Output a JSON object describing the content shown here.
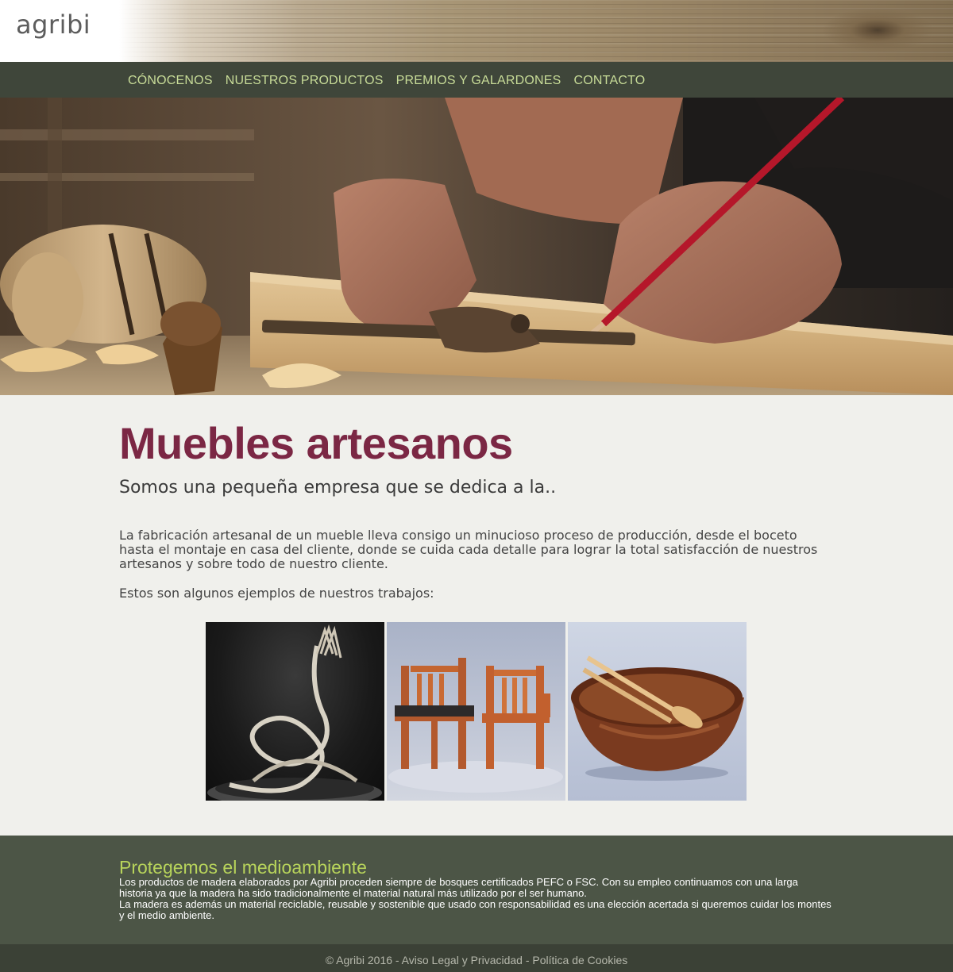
{
  "brand": {
    "logo_text": "agribi"
  },
  "nav": {
    "items": [
      {
        "label": "CÓNOCENOS"
      },
      {
        "label": "NUESTROS PRODUCTOS"
      },
      {
        "label": "PREMIOS Y GALARDONES"
      },
      {
        "label": "CONTACTO"
      }
    ]
  },
  "main": {
    "title": "Muebles artesanos",
    "subtitle": "Somos una pequeña empresa que se dedica a la..",
    "paragraph": "La fabricación artesanal de un mueble lleva consigo un minucioso proceso de producción, desde el boceto hasta el montaje en casa del cliente, donde se cuida cada detalle para lograr la total satisfacción de nuestros artesanos y sobre todo de nuestro cliente.",
    "examples_text": "Estos son algunos ejemplos de nuestros trabajos:"
  },
  "gallery": {
    "images": [
      {
        "name": "wood-sculpture-image"
      },
      {
        "name": "wooden-chairs-image"
      },
      {
        "name": "wooden-bowl-image"
      }
    ]
  },
  "eco": {
    "title": "Protegemos el medioambiente",
    "text1": "Los productos de madera elaborados por Agribi proceden siempre de bosques certificados PEFC o FSC. Con su empleo continuamos con una larga historia ya que la madera ha sido tradicionalmente el material natural más utilizado por el ser humano.",
    "text2": "La madera es además un material reciclable, reusable y sostenible que usado con responsabilidad es una elección acertada si queremos cuidar los montes y el medio ambiente."
  },
  "footer": {
    "text": "© Agribi 2016 - Aviso Legal y Privacidad - Política de Cookies"
  },
  "colors": {
    "nav_bg": "#3f463a",
    "nav_text": "#c8dc98",
    "title": "#7b2744",
    "eco_bg": "#4c5546",
    "eco_title": "#b8d45b",
    "footer_bg": "#3b4136"
  }
}
